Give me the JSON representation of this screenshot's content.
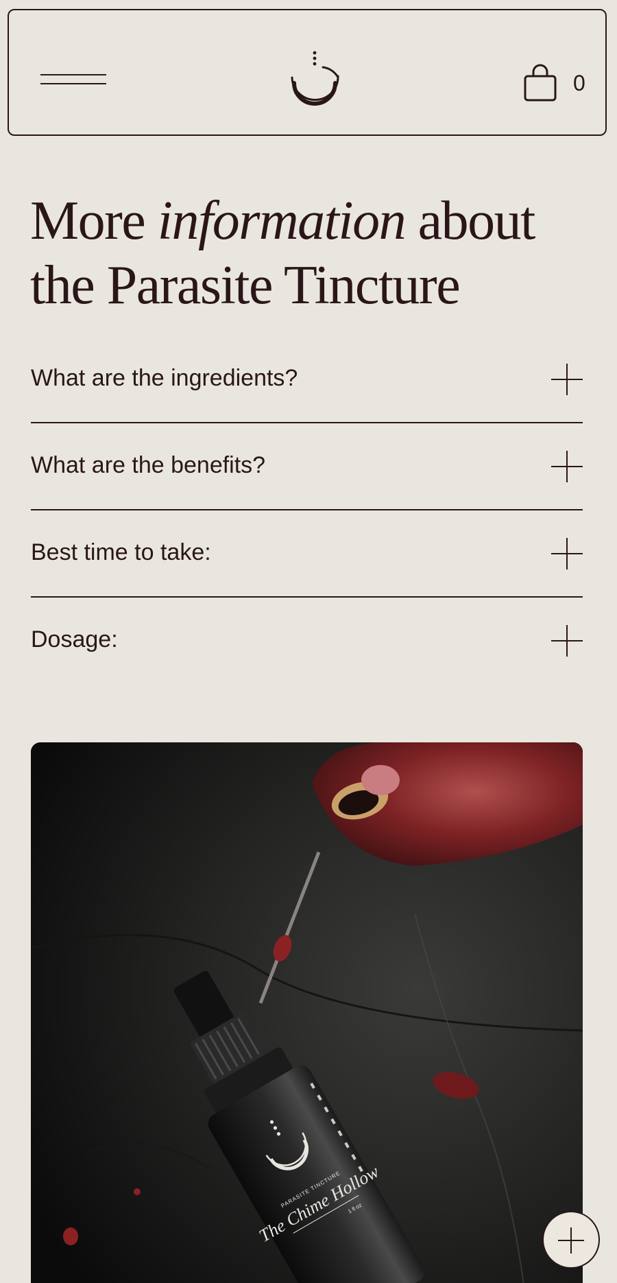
{
  "header": {
    "menu_icon": "hamburger-menu-icon",
    "logo_icon": "crescent-moon-logo-icon",
    "cart_icon": "shopping-bag-icon",
    "cart_count": "0"
  },
  "title": {
    "part1": "More",
    "emphasis": "information",
    "part2": "about",
    "line2": "the Parasite Tincture"
  },
  "faq": {
    "items": [
      {
        "question": "What are the ingredients?"
      },
      {
        "question": "What are the benefits?"
      },
      {
        "question": "Best time to take:"
      },
      {
        "question": "Dosage:"
      }
    ],
    "expand_icon": "plus-icon"
  },
  "photo": {
    "bottle_label_small": "PARASITE TINCTURE",
    "bottle_label_brand": "The Chime Hollow",
    "bottle_volume": "1 fl oz"
  },
  "fab": {
    "icon": "plus-icon"
  },
  "colors": {
    "background": "#e9e6df",
    "ink": "#2a1618",
    "photo_dark": "#111010",
    "pomegranate": "#8c2124"
  }
}
